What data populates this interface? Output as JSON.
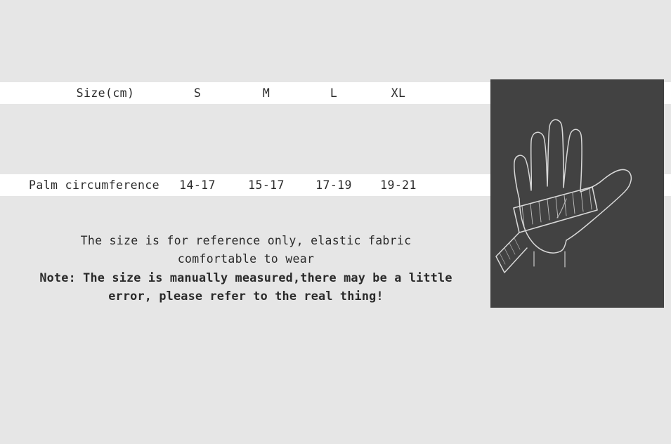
{
  "size_table": {
    "header": {
      "label": "Size(cm)",
      "columns": [
        "S",
        "M",
        "L",
        "XL"
      ]
    },
    "rows": [
      {
        "label": "Palm circumference",
        "values": [
          "14-17",
          "15-17",
          "17-19",
          "19-21"
        ]
      }
    ]
  },
  "notes": {
    "line1": "The size is for reference only, elastic fabric",
    "line2": "comfortable to wear",
    "line3": "Note: The size is manually measured,there may be a little",
    "line4": "error, please refer to the real thing!"
  },
  "illustration": {
    "name": "hand-with-measuring-tape",
    "background_color": "#424242",
    "line_color": "#d8d8d8"
  },
  "theme": {
    "page_background": "#e6e6e6",
    "stripe_background": "#ffffff",
    "text_color": "#2a2a2a"
  }
}
